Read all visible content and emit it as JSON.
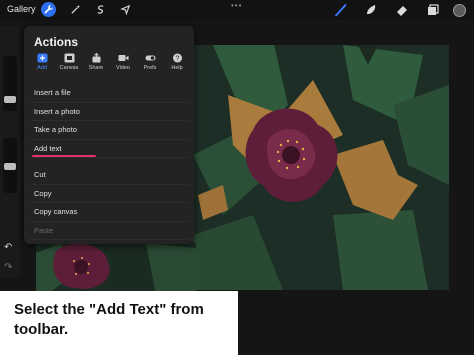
{
  "topbar": {
    "gallery_label": "Gallery",
    "more_dots": "•••",
    "icons": [
      "wrench-icon",
      "magic-wand-icon",
      "selection-icon",
      "transform-icon",
      "brush-icon",
      "smudge-icon",
      "eraser-icon",
      "layers-icon",
      "color-icon"
    ],
    "accent": "#2d6ff0",
    "brush_color": "#3a7bff"
  },
  "panel": {
    "title": "Actions",
    "tabs": [
      {
        "label": "Add",
        "icon": "add-icon",
        "active": true
      },
      {
        "label": "Canvas",
        "icon": "canvas-icon"
      },
      {
        "label": "Share",
        "icon": "share-icon"
      },
      {
        "label": "Video",
        "icon": "video-icon"
      },
      {
        "label": "Prefs",
        "icon": "toggle-icon"
      },
      {
        "label": "Help",
        "icon": "help-icon"
      }
    ],
    "items": [
      {
        "label": "Insert a file"
      },
      {
        "label": "Insert a photo"
      },
      {
        "label": "Take a photo"
      },
      {
        "label": "Add text",
        "highlight": true
      },
      {
        "label": "Cut"
      },
      {
        "label": "Copy"
      },
      {
        "label": "Copy canvas"
      },
      {
        "label": "Paste",
        "disabled": true
      }
    ],
    "highlight_color": "#e2306b"
  },
  "caption": {
    "text": "Select the \"Add Text\" from toolbar."
  }
}
